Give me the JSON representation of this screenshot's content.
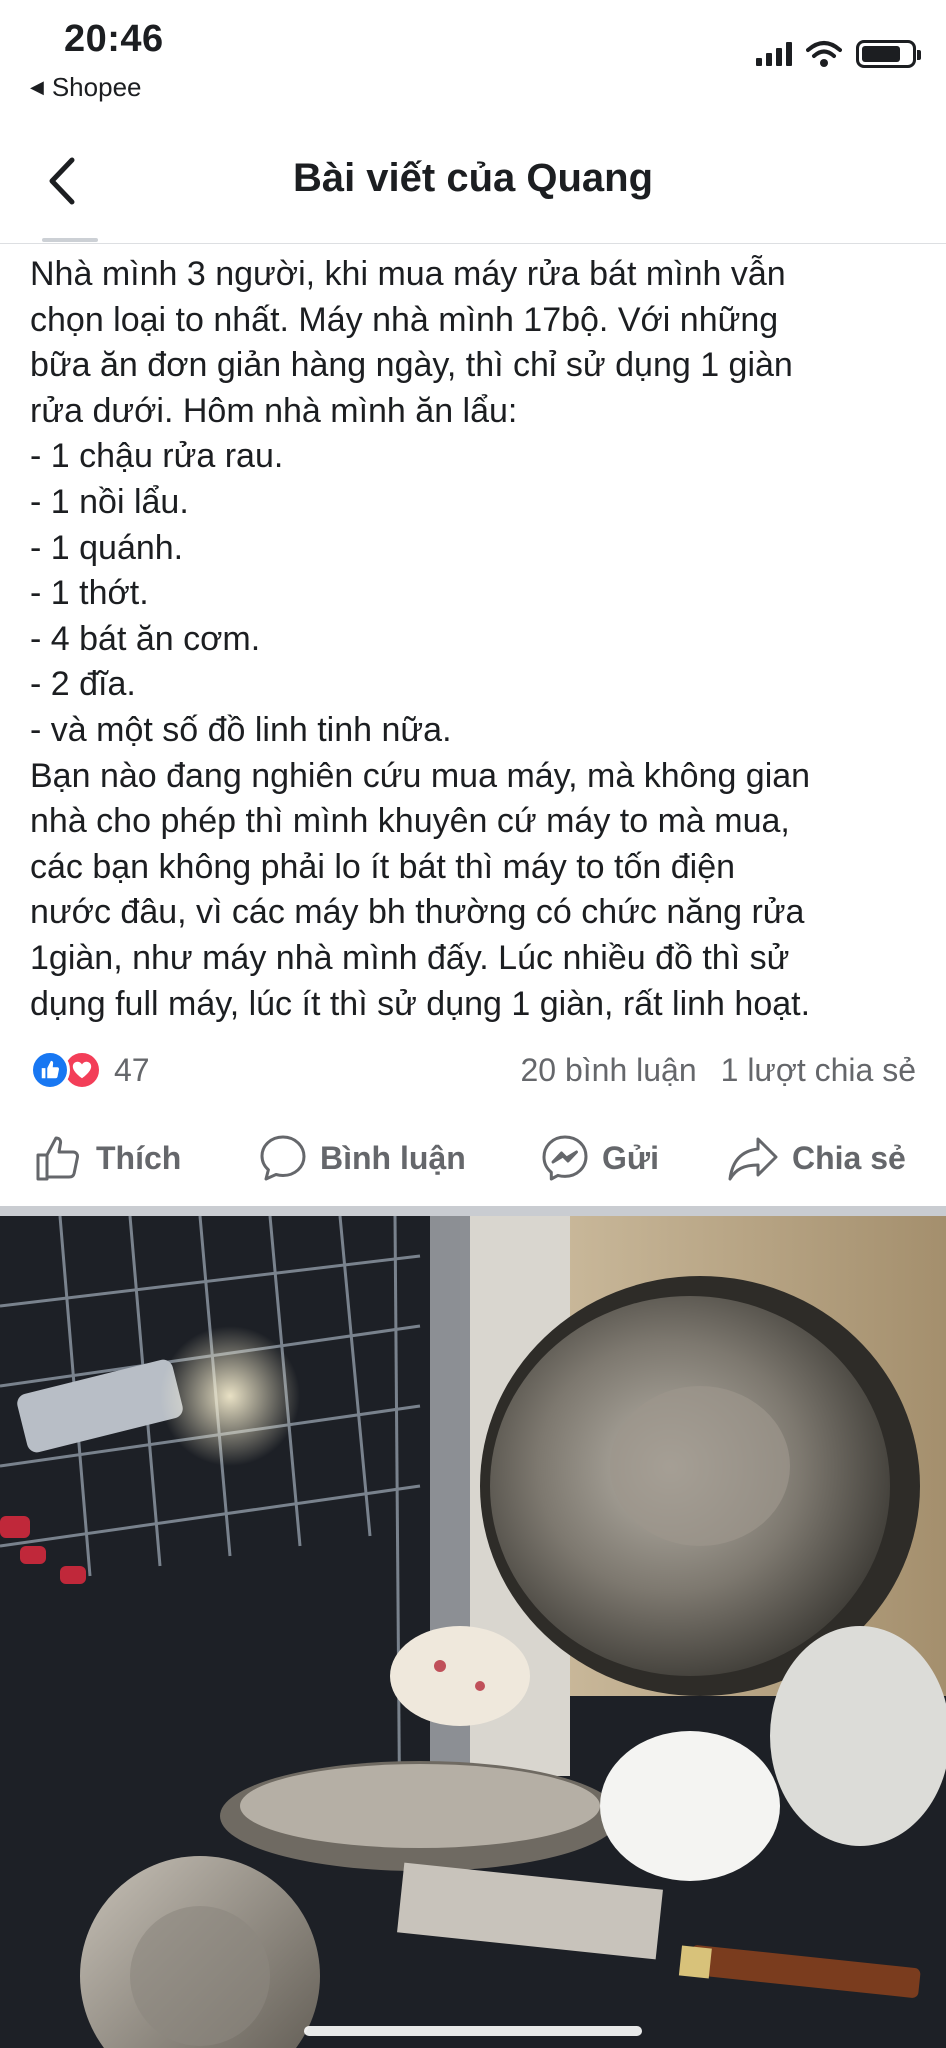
{
  "status_bar": {
    "time": "20:46",
    "back_app": "Shopee"
  },
  "nav": {
    "title": "Bài viết của Quang"
  },
  "post": {
    "lines": [
      "Nhà mình 3 người, khi mua máy rửa bát mình vẫn",
      "chọn loại to nhất. Máy nhà mình 17bộ. Với những",
      "bữa ăn đơn giản hàng ngày, thì chỉ sử dụng 1 giàn",
      "rửa dưới. Hôm nhà mình ăn lẩu:",
      "- 1 chậu rửa rau.",
      "- 1 nồi lẩu.",
      "- 1 quánh.",
      "- 1 thớt.",
      "- 4 bát ăn cơm.",
      "- 2 đĩa.",
      "- và một số đồ linh tinh nữa.",
      "Bạn nào đang nghiên cứu mua máy, mà không gian",
      "nhà cho phép thì mình khuyên cứ máy to mà mua,",
      "các bạn không phải lo ít bát thì máy to  tốn điện",
      "nước đâu, vì các máy bh thường có chức năng rửa",
      "1giàn, như máy nhà mình đấy. Lúc nhiều đồ thì sử",
      "dụng full máy, lúc ít thì sử dụng 1 giàn, rất linh hoạt."
    ]
  },
  "summary": {
    "reaction_count": "47",
    "comments": "20 bình luận",
    "shares": "1 lượt chia sẻ"
  },
  "actions": {
    "like": "Thích",
    "comment": "Bình luận",
    "send": "Gửi",
    "share": "Chia sẻ"
  },
  "colors": {
    "like_blue": "#1877f2",
    "love_red": "#f33e58",
    "secondary_text": "#65676b"
  }
}
